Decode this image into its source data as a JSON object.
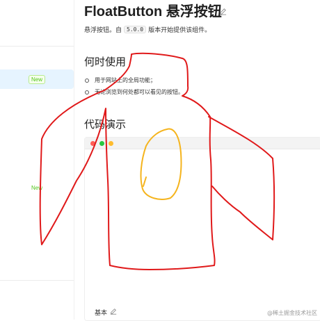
{
  "header": {
    "title": "FloatButton 悬浮按钮",
    "edit_icon": "edit-icon"
  },
  "intro": {
    "prefix": "悬浮按钮。自",
    "version": "5.0.0",
    "suffix": "版本开始提供该组件。"
  },
  "when_to_use": {
    "heading": "何时使用",
    "items": [
      "用于网站上的全局功能；",
      "无论浏览到何处都可以看见的按钮。"
    ]
  },
  "demos": {
    "heading": "代码演示",
    "window_dots": [
      "#ff5f57",
      "#28c840",
      "#febc2e"
    ],
    "footer_label": "基本"
  },
  "sidebar": {
    "badges": [
      "New",
      "New"
    ]
  },
  "watermark": "@稀土掘金技术社区",
  "colors": {
    "drawing_red": "#e0191a",
    "drawing_yellow": "#f5b41d",
    "badge_green": "#52c41a",
    "active_bg": "#e6f4ff"
  }
}
